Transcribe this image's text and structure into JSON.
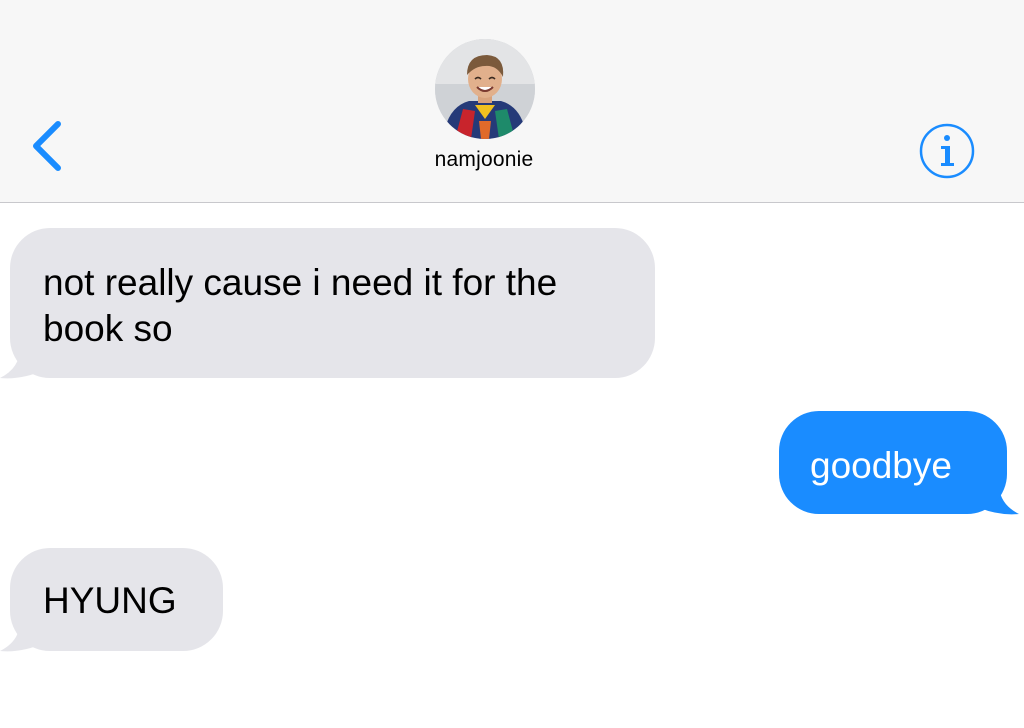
{
  "header": {
    "contact_name": "namjoonie",
    "back_icon": "chevron-left-icon",
    "info_icon": "info-icon",
    "accent_color": "#1a8cff"
  },
  "messages": [
    {
      "direction": "received",
      "text": "not really cause i need it for the book so"
    },
    {
      "direction": "sent",
      "text": "goodbye"
    },
    {
      "direction": "received",
      "text": "HYUNG"
    }
  ],
  "colors": {
    "received_bubble": "#e5e5ea",
    "sent_bubble": "#1a8cff",
    "header_background": "#f7f7f7"
  }
}
